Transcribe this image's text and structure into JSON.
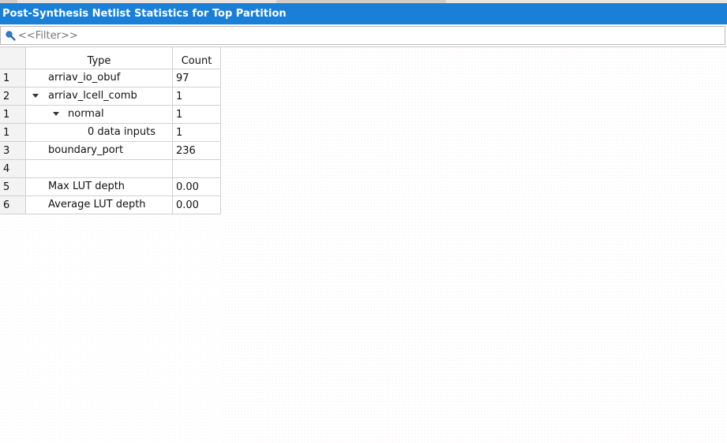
{
  "panel": {
    "title": "Post-Synthesis Netlist Statistics for Top Partition"
  },
  "filter": {
    "placeholder": "<<Filter>>"
  },
  "table": {
    "headers": {
      "type": "Type",
      "count": "Count"
    },
    "rows": [
      {
        "num": "1",
        "type": "arriav_io_obuf",
        "count": "97",
        "expander": false
      },
      {
        "num": "2",
        "type": "arriav_lcell_comb",
        "count": "1",
        "expander": true
      },
      {
        "num": "1",
        "type": "normal",
        "count": "1",
        "expander": true
      },
      {
        "num": "1",
        "type": "0 data inputs",
        "count": "1",
        "expander": false
      },
      {
        "num": "3",
        "type": "boundary_port",
        "count": "236",
        "expander": false
      },
      {
        "num": "4",
        "type": "",
        "count": "",
        "expander": false
      },
      {
        "num": "5",
        "type": "Max LUT depth",
        "count": "0.00",
        "expander": false
      },
      {
        "num": "6",
        "type": "Average LUT depth",
        "count": "0.00",
        "expander": false
      }
    ]
  },
  "icons": {
    "search": "search-icon",
    "expander": "triangle-down-icon"
  },
  "colors": {
    "title_bar": "#1a7fd6",
    "title_text": "#ffffff",
    "grid_line": "#d0d0d0",
    "row_header_bg": "#f3f3f3"
  }
}
